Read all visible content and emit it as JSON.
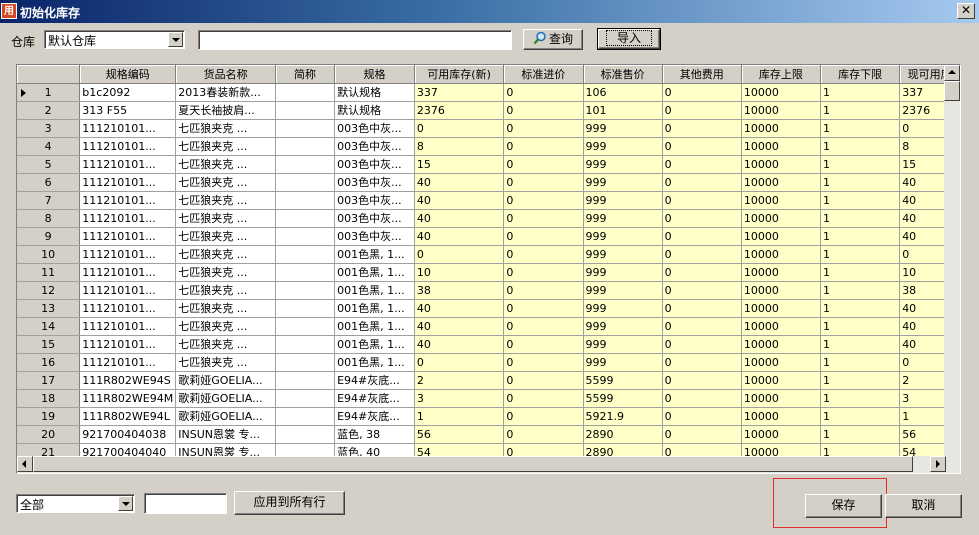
{
  "window": {
    "icon_text": "用",
    "title": "初始化库存",
    "close_label": "✕"
  },
  "toolbar": {
    "warehouse_label": "仓库",
    "warehouse_value": "默认仓库",
    "search_value": "",
    "query_label": "查询",
    "import_label": "导入"
  },
  "grid": {
    "columns": [
      "规格编码",
      "货品名称",
      "简称",
      "规格",
      "可用库存(新)",
      "标准进价",
      "标准售价",
      "其他费用",
      "库存上限",
      "库存下限",
      "现可用库"
    ],
    "rows": [
      [
        "1",
        "b1c2092",
        "2013春装新款...",
        "",
        "默认规格",
        "337",
        "0",
        "106",
        "0",
        "10000",
        "1",
        "337"
      ],
      [
        "2",
        "313 F55",
        "夏天长袖披肩...",
        "",
        "默认规格",
        "2376",
        "0",
        "101",
        "0",
        "10000",
        "1",
        "2376"
      ],
      [
        "3",
        "111210101...",
        "七匹狼夹克 ...",
        "",
        "003色中灰...",
        "0",
        "0",
        "999",
        "0",
        "10000",
        "1",
        "0"
      ],
      [
        "4",
        "111210101...",
        "七匹狼夹克 ...",
        "",
        "003色中灰...",
        "8",
        "0",
        "999",
        "0",
        "10000",
        "1",
        "8"
      ],
      [
        "5",
        "111210101...",
        "七匹狼夹克 ...",
        "",
        "003色中灰...",
        "15",
        "0",
        "999",
        "0",
        "10000",
        "1",
        "15"
      ],
      [
        "6",
        "111210101...",
        "七匹狼夹克 ...",
        "",
        "003色中灰...",
        "40",
        "0",
        "999",
        "0",
        "10000",
        "1",
        "40"
      ],
      [
        "7",
        "111210101...",
        "七匹狼夹克 ...",
        "",
        "003色中灰...",
        "40",
        "0",
        "999",
        "0",
        "10000",
        "1",
        "40"
      ],
      [
        "8",
        "111210101...",
        "七匹狼夹克 ...",
        "",
        "003色中灰...",
        "40",
        "0",
        "999",
        "0",
        "10000",
        "1",
        "40"
      ],
      [
        "9",
        "111210101...",
        "七匹狼夹克 ...",
        "",
        "003色中灰...",
        "40",
        "0",
        "999",
        "0",
        "10000",
        "1",
        "40"
      ],
      [
        "10",
        "111210101...",
        "七匹狼夹克 ...",
        "",
        "001色黑, 1...",
        "0",
        "0",
        "999",
        "0",
        "10000",
        "1",
        "0"
      ],
      [
        "11",
        "111210101...",
        "七匹狼夹克 ...",
        "",
        "001色黑, 1...",
        "10",
        "0",
        "999",
        "0",
        "10000",
        "1",
        "10"
      ],
      [
        "12",
        "111210101...",
        "七匹狼夹克 ...",
        "",
        "001色黑, 1...",
        "38",
        "0",
        "999",
        "0",
        "10000",
        "1",
        "38"
      ],
      [
        "13",
        "111210101...",
        "七匹狼夹克 ...",
        "",
        "001色黑, 1...",
        "40",
        "0",
        "999",
        "0",
        "10000",
        "1",
        "40"
      ],
      [
        "14",
        "111210101...",
        "七匹狼夹克 ...",
        "",
        "001色黑, 1...",
        "40",
        "0",
        "999",
        "0",
        "10000",
        "1",
        "40"
      ],
      [
        "15",
        "111210101...",
        "七匹狼夹克 ...",
        "",
        "001色黑, 1...",
        "40",
        "0",
        "999",
        "0",
        "10000",
        "1",
        "40"
      ],
      [
        "16",
        "111210101...",
        "七匹狼夹克 ...",
        "",
        "001色黑, 1...",
        "0",
        "0",
        "999",
        "0",
        "10000",
        "1",
        "0"
      ],
      [
        "17",
        "111R802WE94S",
        "歌莉娅GOELIA...",
        "",
        "E94#灰底...",
        "2",
        "0",
        "5599",
        "0",
        "10000",
        "1",
        "2"
      ],
      [
        "18",
        "111R802WE94M",
        "歌莉娅GOELIA...",
        "",
        "E94#灰底...",
        "3",
        "0",
        "5599",
        "0",
        "10000",
        "1",
        "3"
      ],
      [
        "19",
        "111R802WE94L",
        "歌莉娅GOELIA...",
        "",
        "E94#灰底...",
        "1",
        "0",
        "5921.9",
        "0",
        "10000",
        "1",
        "1"
      ],
      [
        "20",
        "921700404038",
        "INSUN恩裳 专...",
        "",
        "蓝色, 38",
        "56",
        "0",
        "2890",
        "0",
        "10000",
        "1",
        "56"
      ],
      [
        "21",
        "921700404040",
        "INSUN恩裳 专...",
        "",
        "蓝色, 40",
        "54",
        "0",
        "2890",
        "0",
        "10000",
        "1",
        "54"
      ]
    ]
  },
  "bottom": {
    "scope_value": "全部",
    "apply_value": "",
    "apply_all_label": "应用到所有行",
    "save_label": "保存",
    "cancel_label": "取消"
  },
  "colors": {
    "editable_cell": "#ffffc8",
    "highlight": "#e0302e",
    "title_bar": "#0a246a"
  }
}
